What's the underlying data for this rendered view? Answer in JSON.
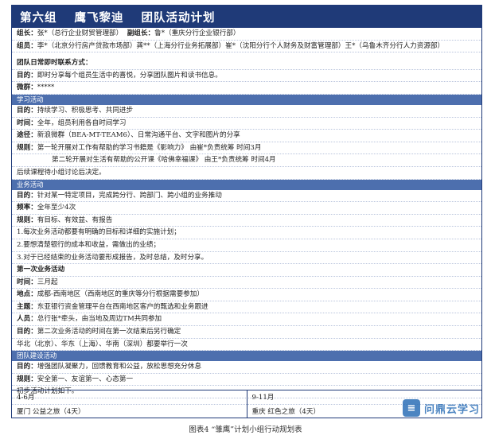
{
  "title": {
    "group": "第六组",
    "name": "鹰飞黎迪",
    "plan": "团队活动计划"
  },
  "header_rows": [
    {
      "label": "组长：",
      "text": "张*（总行企业财贸管理部）",
      "label2": "副组长：",
      "text2": "鲁*（重庆分行企业银行部）"
    },
    {
      "label": "组员：",
      "text": "李*（北京分行房产贷款市场部）龚**（上海分行业务拓展部）崔*（沈阳分行个人财务及财富管理部）王*（乌鲁木齐分行人力资源部）"
    }
  ],
  "comm": {
    "heading": "团队日常即时联系方式：",
    "rows": [
      {
        "label": "目的：",
        "text": "即时分享每个组员生活中的喜悦，分享团队图片和读书信息。"
      },
      {
        "label": "微群：",
        "text": "*****"
      }
    ]
  },
  "learning": {
    "heading": "学习活动",
    "rows": [
      {
        "label": "目的：",
        "text": "持续学习、积极思考、共同进步"
      },
      {
        "label": "时间：",
        "text": "全年，组员利用各自时间学习"
      },
      {
        "label": "途径：",
        "text": "新浪微群（BEA-MT-TEAM6）、日常沟通平台、文字和图片的分享"
      },
      {
        "label": "规则：",
        "text": "第一轮开展对工作有帮助的学习书籍是《影响力》 由崔*负责统筹  时间3月"
      },
      {
        "label": "",
        "text": "第二轮开展对生活有帮助的公开课《哈佛幸福课》 由王*负责统筹  时间4月",
        "indent": true
      },
      {
        "label": "",
        "text": "后续课程待小组讨论后决定。"
      }
    ]
  },
  "business": {
    "heading": "业务活动",
    "rows": [
      {
        "label": "目的：",
        "text": "针对某一特定项目，完成跨分行、跨部门、跨小组的业务推动"
      },
      {
        "label": "频率：",
        "text": "全年至少4次"
      },
      {
        "label": "规则：",
        "text": "有目标、有效益、有报告"
      },
      {
        "label": "",
        "text": "1.每次业务活动都要有明确的目标和详细的实施计划；"
      },
      {
        "label": "",
        "text": "2.要想清楚银行的成本和收益，需做出的业绩；"
      },
      {
        "label": "",
        "text": "3.对于已经结束的业务活动要形成报告，及时总结，及时分享。"
      },
      {
        "label": "第一次业务活动",
        "text": ""
      },
      {
        "label": "时间：",
        "text": "三月起"
      },
      {
        "label": "地点：",
        "text": "成都-西南地区（西南地区的重庆等分行根据需要参加）"
      },
      {
        "label": "主题：",
        "text": "东亚银行资金管理平台在西南地区客户的甄选和业务跟进"
      },
      {
        "label": "人员：",
        "text": "总行张*牵头，由当地及周边TM共同参加"
      },
      {
        "label": "目的：",
        "text": "第二次业务活动的时间在第一次结束后另行确定"
      },
      {
        "label": "",
        "text": "华北（北京）、华东（上海）、华南（深圳）都要举行一次"
      }
    ]
  },
  "team": {
    "heading": "团队建设活动",
    "rows": [
      {
        "label": "目的：",
        "text": "增强团队凝聚力，回馈教育和公益，放松思想充分休息"
      },
      {
        "label": "规则：",
        "text": "安全第一、友谊第一、心态第一"
      },
      {
        "label": "",
        "text": "初步活动计划如下。"
      }
    ]
  },
  "schedule": [
    {
      "period": "4-6月",
      "event": "厦门 公益之旅（4天）"
    },
    {
      "period": "9-11月",
      "event": "重庆 红色之旅（4天）"
    }
  ],
  "caption": "图表4  “雏鹰”计划小组行动规划表",
  "watermark": {
    "mark": "≡",
    "text": "问鼎云学习"
  },
  "colors": {
    "header": "#1f3a78",
    "section": "#4d6fae",
    "watermark": "#2c6fb7"
  }
}
